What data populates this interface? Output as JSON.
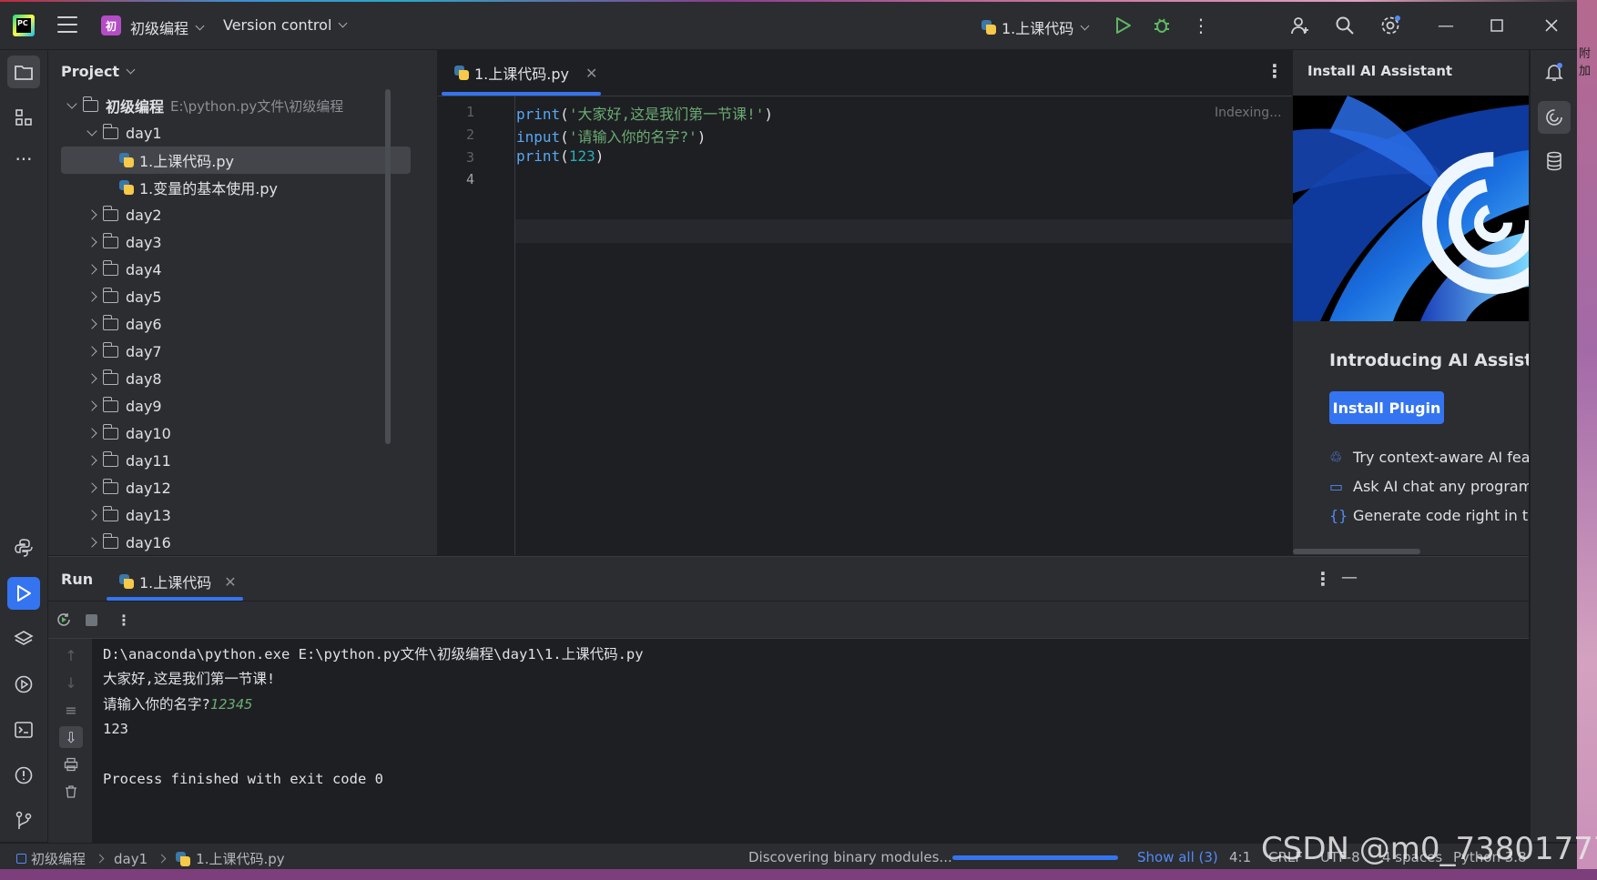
{
  "titlebar": {
    "project_badge": "初",
    "project_name": "初级编程",
    "vcs_label": "Version control",
    "run_config": "1.上课代码"
  },
  "project_panel": {
    "title": "Project",
    "root_name": "初级编程",
    "root_path": "E:\\python.py文件\\初级编程",
    "day1": "day1",
    "files": [
      "1.上课代码.py",
      "1.变量的基本使用.py"
    ],
    "folders": [
      "day2",
      "day3",
      "day4",
      "day5",
      "day6",
      "day7",
      "day8",
      "day9",
      "day10",
      "day11",
      "day12",
      "day13",
      "day16"
    ]
  },
  "editor": {
    "tab_label": "1.上课代码.py",
    "line_numbers": [
      "1",
      "2",
      "3",
      "4"
    ],
    "line1": {
      "fn": "print",
      "open": "(",
      "str": "'大家好,这是我们第一节课!'",
      "close": ")"
    },
    "line2": {
      "fn": "input",
      "open": "(",
      "str": "'请输入你的名字?'",
      "close": ")"
    },
    "line3": {
      "fn": "print",
      "open": "(",
      "num": "123",
      "close": ")"
    },
    "indexing": "Indexing..."
  },
  "ai_panel": {
    "header": "Install AI Assistant",
    "title": "Introducing AI Assistant",
    "install_button": "Install Plugin",
    "features": [
      "Try context-aware AI featu",
      "Ask AI chat any programmi",
      "Generate code right in the"
    ]
  },
  "run_panel": {
    "title": "Run",
    "tab_label": "1.上课代码",
    "console": {
      "command": "D:\\anaconda\\python.exe E:\\python.py文件\\初级编程\\day1\\1.上课代码.py",
      "line1": "大家好,这是我们第一节课!",
      "prompt": "请输入你的名字?",
      "user_input": "12345",
      "line3": "123",
      "exit": "Process finished with exit code 0"
    }
  },
  "statusbar": {
    "breadcrumb": [
      "初级编程",
      "day1",
      "1.上课代码.py"
    ],
    "task": "Discovering binary modules...",
    "progress": 1.0,
    "show_all": "Show all (3)",
    "position": "4:1",
    "line_sep": "CRLF",
    "encoding": "UTF-8",
    "indent": "4 spaces",
    "interpreter": "Python 3.8"
  },
  "watermark": "CSDN @m0_73801777",
  "desktop_text": "附加"
}
